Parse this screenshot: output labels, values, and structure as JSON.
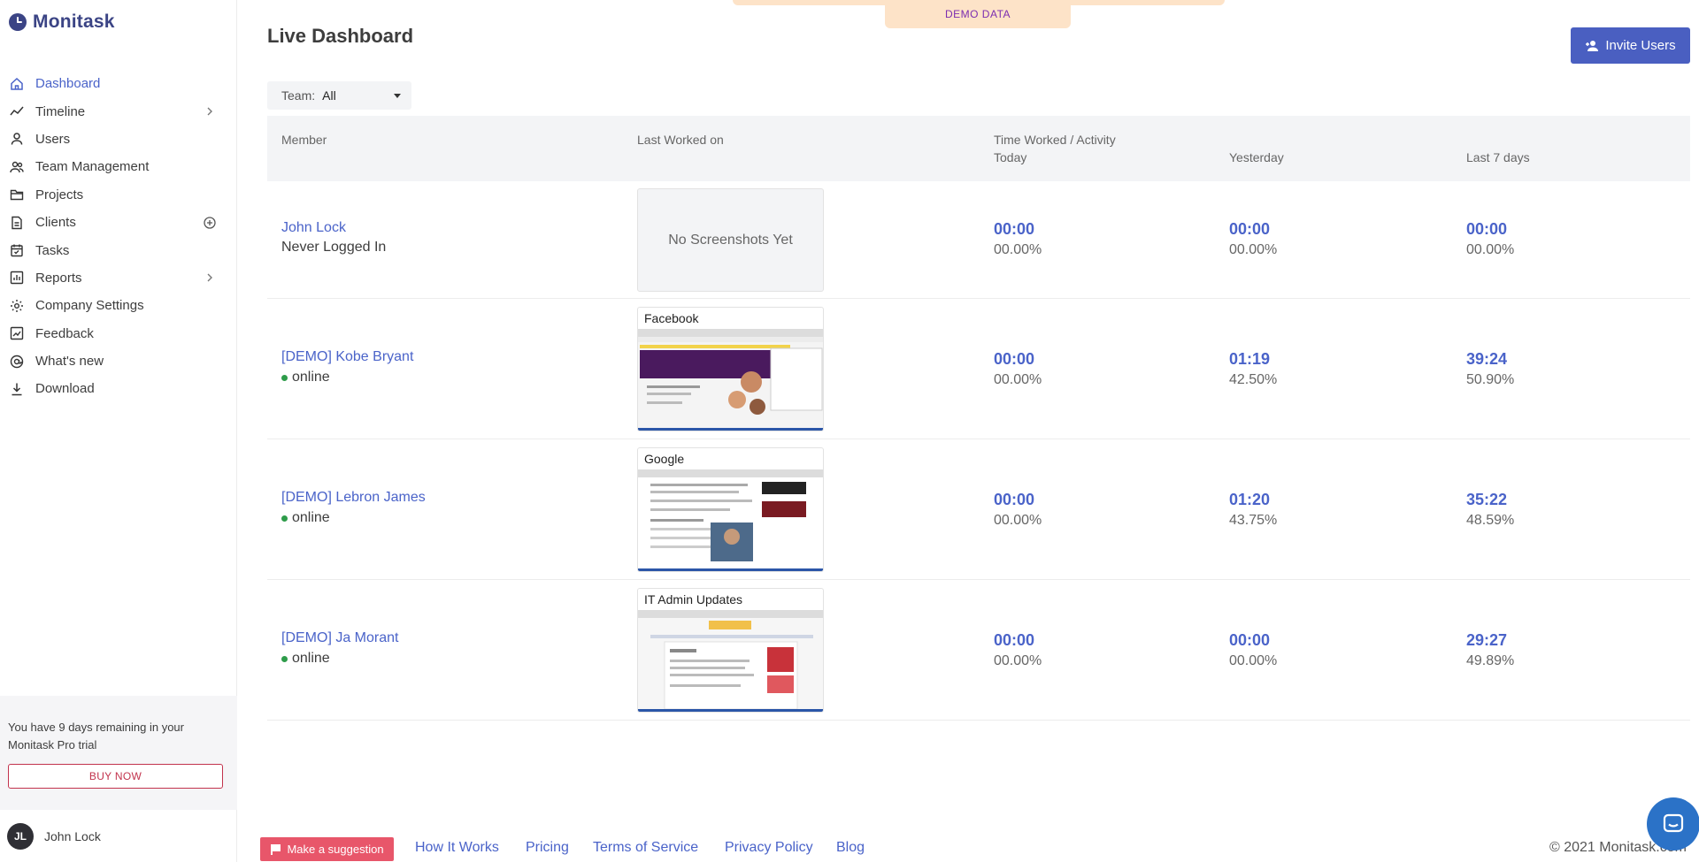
{
  "app": {
    "name": "Monitask"
  },
  "sidebar": {
    "items": [
      {
        "label": "Dashboard",
        "icon": "home-icon",
        "active": true
      },
      {
        "label": "Timeline",
        "icon": "chart-line-icon",
        "expandable": true
      },
      {
        "label": "Users",
        "icon": "user-icon"
      },
      {
        "label": "Team Management",
        "icon": "users-icon"
      },
      {
        "label": "Projects",
        "icon": "folder-icon"
      },
      {
        "label": "Clients",
        "icon": "document-icon",
        "add": true
      },
      {
        "label": "Tasks",
        "icon": "calendar-icon"
      },
      {
        "label": "Reports",
        "icon": "bar-chart-icon",
        "expandable": true
      },
      {
        "label": "Company Settings",
        "icon": "gear-icon"
      },
      {
        "label": "Feedback",
        "icon": "feedback-icon"
      },
      {
        "label": "What's new",
        "icon": "at-icon"
      },
      {
        "label": "Download",
        "icon": "download-icon"
      }
    ],
    "trial_text": "You have 9 days remaining in your Monitask Pro trial",
    "buy_label": "BUY NOW",
    "user": {
      "initials": "JL",
      "name": "John Lock"
    }
  },
  "banner": {
    "label": "DEMO DATA"
  },
  "page": {
    "title": "Live Dashboard",
    "invite_label": "Invite Users",
    "team_filter": {
      "label": "Team:",
      "value": "All"
    }
  },
  "table": {
    "headers": {
      "member": "Member",
      "last_worked": "Last Worked on",
      "time_worked_top": "Time Worked / Activity",
      "today": "Today",
      "yesterday": "Yesterday",
      "last7": "Last 7 days"
    },
    "rows": [
      {
        "name": "John Lock",
        "status": "Never Logged In",
        "online": false,
        "screenshot_title": "",
        "empty_label": "No Screenshots Yet",
        "today_time": "00:00",
        "today_pct": "00.00%",
        "yesterday_time": "00:00",
        "yesterday_pct": "00.00%",
        "last7_time": "00:00",
        "last7_pct": "00.00%"
      },
      {
        "name": "[DEMO] Kobe Bryant",
        "status": "online",
        "online": true,
        "screenshot_title": "Facebook",
        "today_time": "00:00",
        "today_pct": "00.00%",
        "yesterday_time": "01:19",
        "yesterday_pct": "42.50%",
        "last7_time": "39:24",
        "last7_pct": "50.90%"
      },
      {
        "name": "[DEMO] Lebron James",
        "status": "online",
        "online": true,
        "screenshot_title": "Google",
        "today_time": "00:00",
        "today_pct": "00.00%",
        "yesterday_time": "01:20",
        "yesterday_pct": "43.75%",
        "last7_time": "35:22",
        "last7_pct": "48.59%"
      },
      {
        "name": "[DEMO] Ja Morant",
        "status": "online",
        "online": true,
        "screenshot_title": "IT Admin Updates",
        "today_time": "00:00",
        "today_pct": "00.00%",
        "yesterday_time": "00:00",
        "yesterday_pct": "00.00%",
        "last7_time": "29:27",
        "last7_pct": "49.89%"
      }
    ]
  },
  "footer": {
    "suggest_label": "Make a suggestion",
    "links": [
      "How It Works",
      "Pricing",
      "Terms of Service",
      "Privacy Policy",
      "Blog"
    ],
    "copyright": "© 2021 Monitask.com"
  },
  "colors": {
    "accent": "#4a63c9",
    "brand": "#3b4485",
    "buy": "#c2334d",
    "suggest": "#e8566a",
    "online": "#2e9c4a"
  }
}
